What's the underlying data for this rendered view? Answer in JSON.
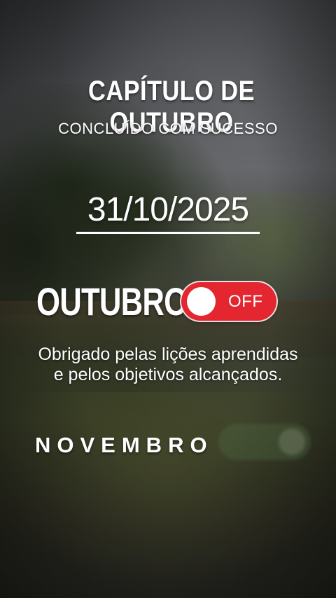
{
  "header": {
    "title": "CAPÍTULO DE OUTUBRO",
    "subtitle": "CONCLUÍDO COM SUCESSO"
  },
  "date": "31/10/2025",
  "current_month": {
    "label": "OUTUBRO",
    "toggle_state": "OFF",
    "toggle_color": "#e3262f"
  },
  "message": {
    "line1": "Obrigado pelas lições aprendidas",
    "line2": "e pelos objetivos alcançados."
  },
  "next_month": {
    "label": "NOVEMBRO"
  }
}
